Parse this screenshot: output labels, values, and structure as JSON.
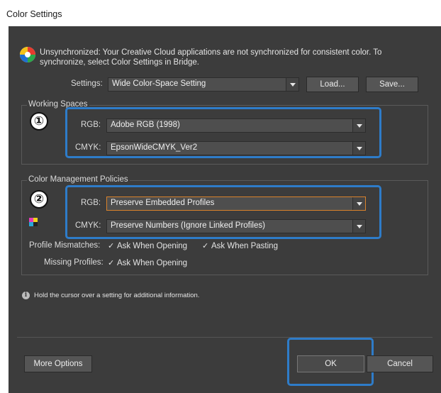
{
  "window": {
    "title": "Color Settings"
  },
  "sync": {
    "icon": "color-wheel-icon",
    "message_line1": "Unsynchronized: Your Creative Cloud applications are not synchronized for consistent color. To",
    "message_line2": "synchronize, select Color Settings in Bridge."
  },
  "settings": {
    "label": "Settings:",
    "value": "Wide Color-Space Setting",
    "load_label": "Load...",
    "save_label": "Save..."
  },
  "working_spaces": {
    "title": "Working Spaces",
    "marker": "①",
    "rgb_label": "RGB:",
    "rgb_value": "Adobe RGB (1998)",
    "cmyk_label": "CMYK:",
    "cmyk_value": "EpsonWideCMYK_Ver2"
  },
  "policies": {
    "title": "Color Management Policies",
    "marker": "②",
    "rgb_label": "RGB:",
    "rgb_value": "Preserve Embedded Profiles",
    "cmyk_label": "CMYK:",
    "cmyk_value": "Preserve Numbers (Ignore Linked Profiles)",
    "mismatch_label": "Profile Mismatches:",
    "ask_opening": "Ask When Opening",
    "ask_pasting": "Ask When Pasting",
    "missing_label": "Missing Profiles:",
    "missing_ask_opening": "Ask When Opening"
  },
  "info": {
    "text": "Hold the cursor over a setting for additional information."
  },
  "footer": {
    "more_options_label": "More Options",
    "ok_label": "OK",
    "cancel_label": "Cancel"
  },
  "colors": {
    "accent": "#2e7cc9",
    "dialog_bg": "#3c3c3c",
    "focus_orange": "#d9822b"
  }
}
